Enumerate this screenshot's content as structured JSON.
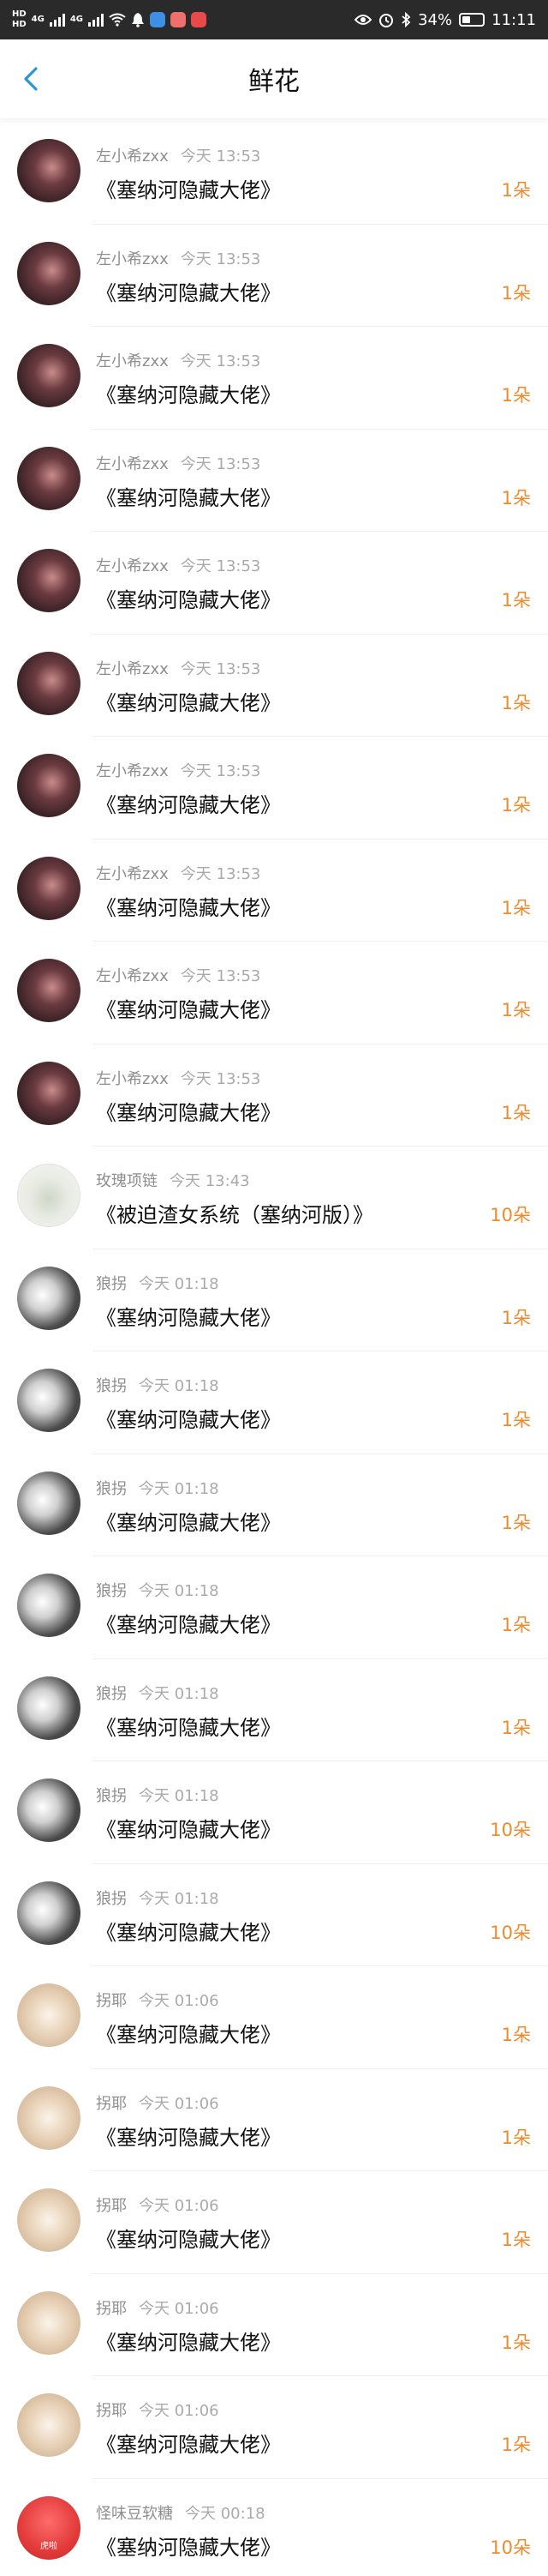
{
  "status_bar": {
    "network_1": "HD",
    "network_2": "HD",
    "sig_label": "4G",
    "sig_label_2": "4G",
    "battery": "34%",
    "time": "11:11"
  },
  "nav": {
    "title": "鲜花"
  },
  "rows": [
    {
      "name": "左小希zxx",
      "time": "今天 13:53",
      "book": "《塞纳河隐藏大佬》",
      "count": "1朵",
      "avatar": "a"
    },
    {
      "name": "左小希zxx",
      "time": "今天 13:53",
      "book": "《塞纳河隐藏大佬》",
      "count": "1朵",
      "avatar": "a"
    },
    {
      "name": "左小希zxx",
      "time": "今天 13:53",
      "book": "《塞纳河隐藏大佬》",
      "count": "1朵",
      "avatar": "a"
    },
    {
      "name": "左小希zxx",
      "time": "今天 13:53",
      "book": "《塞纳河隐藏大佬》",
      "count": "1朵",
      "avatar": "a"
    },
    {
      "name": "左小希zxx",
      "time": "今天 13:53",
      "book": "《塞纳河隐藏大佬》",
      "count": "1朵",
      "avatar": "a"
    },
    {
      "name": "左小希zxx",
      "time": "今天 13:53",
      "book": "《塞纳河隐藏大佬》",
      "count": "1朵",
      "avatar": "a"
    },
    {
      "name": "左小希zxx",
      "time": "今天 13:53",
      "book": "《塞纳河隐藏大佬》",
      "count": "1朵",
      "avatar": "a"
    },
    {
      "name": "左小希zxx",
      "time": "今天 13:53",
      "book": "《塞纳河隐藏大佬》",
      "count": "1朵",
      "avatar": "a"
    },
    {
      "name": "左小希zxx",
      "time": "今天 13:53",
      "book": "《塞纳河隐藏大佬》",
      "count": "1朵",
      "avatar": "a"
    },
    {
      "name": "左小希zxx",
      "time": "今天 13:53",
      "book": "《塞纳河隐藏大佬》",
      "count": "1朵",
      "avatar": "a"
    },
    {
      "name": "玫瑰项链",
      "time": "今天 13:43",
      "book": "《被迫渣女系统（塞纳河版）》",
      "count": "10朵",
      "avatar": "b"
    },
    {
      "name": "狼拐",
      "time": "今天 01:18",
      "book": "《塞纳河隐藏大佬》",
      "count": "1朵",
      "avatar": "c"
    },
    {
      "name": "狼拐",
      "time": "今天 01:18",
      "book": "《塞纳河隐藏大佬》",
      "count": "1朵",
      "avatar": "c"
    },
    {
      "name": "狼拐",
      "time": "今天 01:18",
      "book": "《塞纳河隐藏大佬》",
      "count": "1朵",
      "avatar": "c"
    },
    {
      "name": "狼拐",
      "time": "今天 01:18",
      "book": "《塞纳河隐藏大佬》",
      "count": "1朵",
      "avatar": "c"
    },
    {
      "name": "狼拐",
      "time": "今天 01:18",
      "book": "《塞纳河隐藏大佬》",
      "count": "1朵",
      "avatar": "c"
    },
    {
      "name": "狼拐",
      "time": "今天 01:18",
      "book": "《塞纳河隐藏大佬》",
      "count": "10朵",
      "avatar": "c"
    },
    {
      "name": "狼拐",
      "time": "今天 01:18",
      "book": "《塞纳河隐藏大佬》",
      "count": "10朵",
      "avatar": "c"
    },
    {
      "name": "拐耶",
      "time": "今天 01:06",
      "book": "《塞纳河隐藏大佬》",
      "count": "1朵",
      "avatar": "d"
    },
    {
      "name": "拐耶",
      "time": "今天 01:06",
      "book": "《塞纳河隐藏大佬》",
      "count": "1朵",
      "avatar": "d"
    },
    {
      "name": "拐耶",
      "time": "今天 01:06",
      "book": "《塞纳河隐藏大佬》",
      "count": "1朵",
      "avatar": "d"
    },
    {
      "name": "拐耶",
      "time": "今天 01:06",
      "book": "《塞纳河隐藏大佬》",
      "count": "1朵",
      "avatar": "d"
    },
    {
      "name": "拐耶",
      "time": "今天 01:06",
      "book": "《塞纳河隐藏大佬》",
      "count": "1朵",
      "avatar": "d"
    },
    {
      "name": "怪味豆软糖",
      "time": "今天 00:18",
      "book": "《塞纳河隐藏大佬》",
      "count": "10朵",
      "avatar": "e",
      "avatar_text": "虎啦"
    }
  ],
  "colors": {
    "count": "#f08a2a",
    "back_icon": "#2a95d8",
    "status_bar": "#2a2a2a"
  }
}
